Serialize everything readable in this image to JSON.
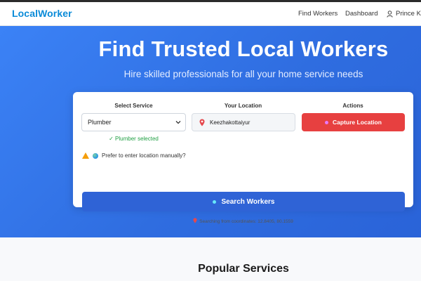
{
  "nav": {
    "brand": "LocalWorker",
    "links": {
      "find_workers": "Find Workers",
      "dashboard": "Dashboard"
    },
    "user_name": "Prince Kur"
  },
  "hero": {
    "title": "Find Trusted Local Workers",
    "subtitle": "Hire skilled professionals for all your home service needs"
  },
  "search_card": {
    "service_label": "Select Service",
    "service_value": "Plumber",
    "service_confirmation": "✓ Plumber selected",
    "location_label": "Your Location",
    "location_value": "Keezhakottaiyur",
    "actions_label": "Actions",
    "capture_button": "Capture Location",
    "manual_prompt": "Prefer to enter location manually?",
    "search_button": "Search Workers",
    "coordinates_text": "Searching from coordinates: 12.8405, 80.1559"
  },
  "popular": {
    "title": "Popular Services"
  },
  "colors": {
    "brand": "#0a8bd8",
    "hero_gradient_start": "#3b82f6",
    "hero_gradient_end": "#2a63d8",
    "capture_button": "#e74040",
    "search_button": "#2f63d6",
    "confirmation": "#22a045"
  }
}
